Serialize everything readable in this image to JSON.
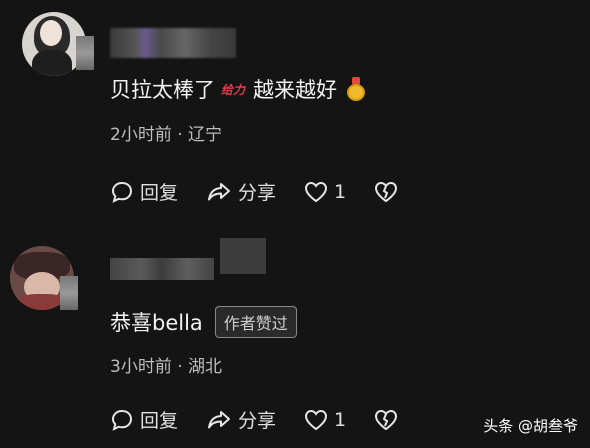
{
  "comments": [
    {
      "text": "贝拉太棒了",
      "sticker": "给力",
      "text2": "越来越好",
      "time_location": "2小时前 · 辽宁",
      "reply_label": "回复",
      "share_label": "分享",
      "like_count": "1",
      "icons": {
        "reply": "comment-bubble-icon",
        "share": "share-arrow-icon",
        "like": "heart-icon",
        "dislike": "broken-heart-icon",
        "medal": "medal-icon"
      }
    },
    {
      "text": "恭喜bella",
      "badge": "作者赞过",
      "time_location": "3小时前 · 湖北",
      "reply_label": "回复",
      "share_label": "分享",
      "like_count": "1",
      "icons": {
        "reply": "comment-bubble-icon",
        "share": "share-arrow-icon",
        "like": "heart-icon",
        "dislike": "broken-heart-icon"
      }
    }
  ],
  "watermark": "头条 @胡叁爷"
}
